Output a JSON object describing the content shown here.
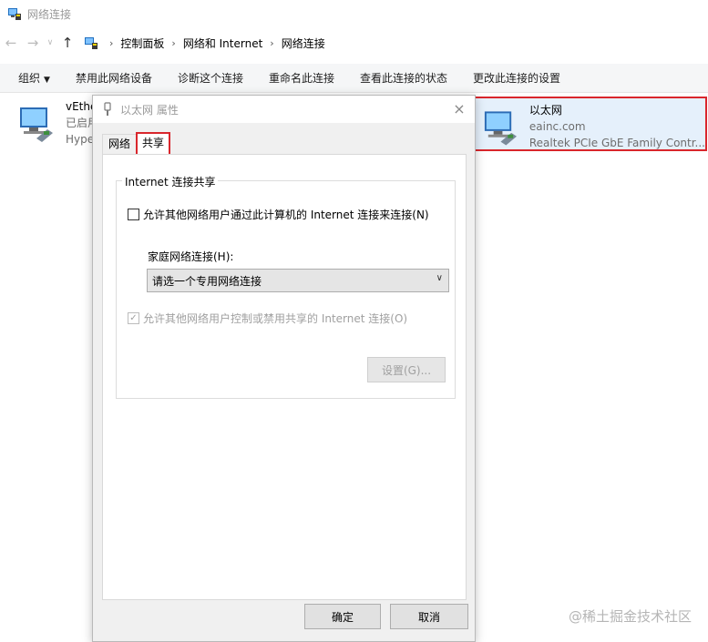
{
  "window": {
    "title": "网络连接"
  },
  "address": {
    "crumbs": [
      "控制面板",
      "网络和 Internet",
      "网络连接"
    ]
  },
  "commands": [
    {
      "label": "组织",
      "has_caret": true
    },
    {
      "label": "禁用此网络设备"
    },
    {
      "label": "诊断这个连接"
    },
    {
      "label": "重命名此连接"
    },
    {
      "label": "查看此连接的状态"
    },
    {
      "label": "更改此连接的设置"
    }
  ],
  "connections": {
    "left": {
      "name": "vEthe",
      "status": "已启用",
      "device": "Hype"
    },
    "right": {
      "name": "以太网",
      "status": "eainc.com",
      "device": "Realtek PCIe GbE Family Contr..."
    }
  },
  "dialog": {
    "title": "以太网 属性",
    "close_glyph": "×",
    "tabs": [
      "网络",
      "共享"
    ],
    "group_title": "Internet 连接共享",
    "allow_share_label": "允许其他网络用户通过此计算机的 Internet 连接来连接(N)",
    "allow_share_checked": false,
    "home_network_label": "家庭网络连接(H):",
    "home_network_value": "请选一个专用网络连接",
    "allow_control_label": "允许其他网络用户控制或禁用共享的 Internet 连接(O)",
    "allow_control_checked": true,
    "settings_button": "设置(G)...",
    "ok_button": "确定",
    "cancel_button": "取消"
  },
  "watermark": "@稀土掘金技术社区",
  "colors": {
    "highlight_border": "#d9262c",
    "selection_bg": "#e5f0fb"
  }
}
